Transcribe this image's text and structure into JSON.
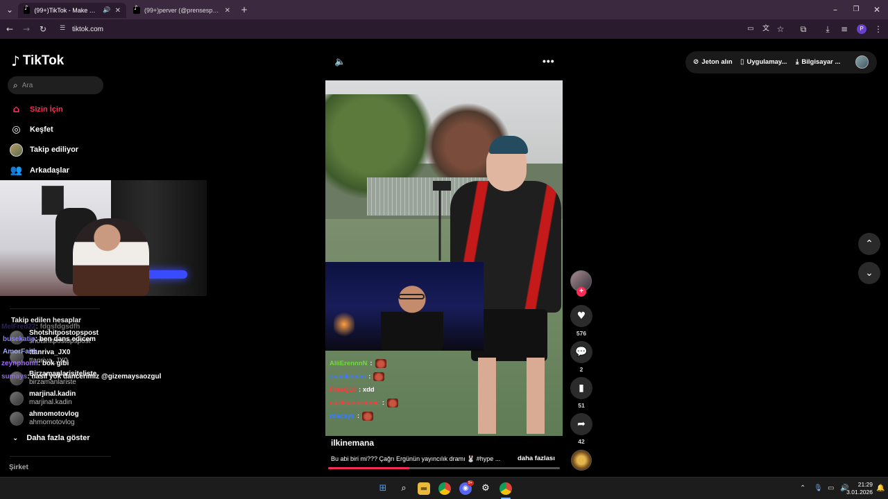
{
  "browser": {
    "tabs": [
      {
        "title": "(99+)TikTok - Make Your Da",
        "active": true
      },
      {
        "title": "(99+)perver (@prensesperver) |",
        "active": false
      }
    ],
    "url": "tiktok.com",
    "profile_initial": "P"
  },
  "sidebar": {
    "brand": "TikTok",
    "search_placeholder": "Ara",
    "nav": [
      {
        "label": "Sizin İçin",
        "icon": "home-icon",
        "active": true
      },
      {
        "label": "Keşfet",
        "icon": "compass-icon",
        "active": false
      },
      {
        "label": "Takip ediliyor",
        "icon": "avatar",
        "active": false
      },
      {
        "label": "Arkadaşlar",
        "icon": "friends-icon",
        "active": false
      }
    ],
    "following_title": "Takip edilen hesaplar",
    "accounts": [
      {
        "name": "Shotshitpostopspost",
        "handle": "shotshitpostopspost"
      },
      {
        "name": "ttanriva_JX0",
        "handle": "ttanriva_JX0"
      },
      {
        "name": "Birzamanlarisiteliste",
        "handle": "birzamanlariste"
      },
      {
        "name": "marjinal.kadin",
        "handle": "marjinal.kadin"
      },
      {
        "name": "ahmomotovlog",
        "handle": "ahmomotovlog"
      }
    ],
    "show_more": "Daha fazla göster",
    "company": "Şirket"
  },
  "left_chat": [
    {
      "user": "MelFred22",
      "msg": ": fdgsfdgsdfh",
      "color": "#5a4bd6"
    },
    {
      "user": "busekatip",
      "msg": ": ben dans edicem",
      "color": "#8a7cff"
    },
    {
      "user": "AmorFaith",
      "msg": "",
      "color": "#a0a8ff"
    },
    {
      "user": "zeynphonn",
      "msg": ": bok gibi",
      "color": "#a46bff"
    },
    {
      "user": "sumays",
      "msg": ": nasıl yok dancerimiz @gizemaysaozgul",
      "color": "#8a6bd6"
    }
  ],
  "player": {
    "author": "ilkinemana",
    "description": "Bu abi biri mi??? Çağrı Ergünün yayıncılık dramı 🐰 #hype ...",
    "more_label": "daha fazlası",
    "progress": 0.35,
    "chat": [
      {
        "user": "AliiErennnN",
        "msg": ":",
        "color": "#6fdc3a",
        "emote": true
      },
      {
        "user": "ucankeman",
        "msg": ":",
        "color": "#3a7cff",
        "emote": true
      },
      {
        "user": "FreeQ10",
        "msg": ": xdd",
        "color": "#ff3a3a",
        "emote": false
      },
      {
        "user": "nazlicanurneme",
        "msg": ":",
        "color": "#ff3a3a",
        "emote": true
      },
      {
        "user": "rdacsys",
        "msg": ":",
        "color": "#3a7cff",
        "emote": true
      }
    ]
  },
  "actions": {
    "likes": "576",
    "comments": "2",
    "saves": "51",
    "shares": "42"
  },
  "topbar": {
    "coins": "Jeton alın",
    "app": "Uygulamay...",
    "desktop": "Bilgisayar ..."
  },
  "taskbar": {
    "time": "21:29",
    "date": "3.01.2026",
    "discord_badge": "9+"
  }
}
